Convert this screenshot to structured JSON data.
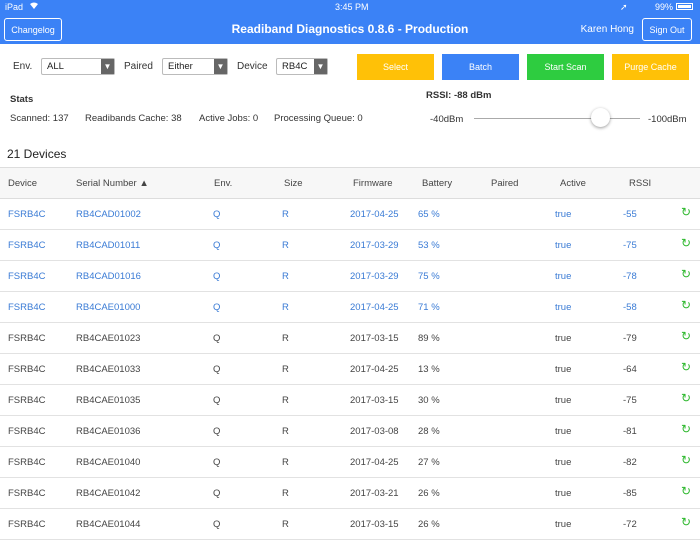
{
  "statusbar": {
    "device": "iPad",
    "time": "3:45 PM",
    "battery": "99%"
  },
  "header": {
    "changelog": "Changelog",
    "title": "Readiband Diagnostics 0.8.6 - Production",
    "user": "Karen Hong",
    "signout": "Sign Out"
  },
  "filters": {
    "env_label": "Env.",
    "env_value": "ALL",
    "paired_label": "Paired",
    "paired_value": "Either",
    "device_label": "Device",
    "device_value": "RB4C"
  },
  "actions": {
    "select": "Select",
    "batch": "Batch",
    "start_scan": "Start Scan",
    "purge_cache": "Purge Cache"
  },
  "colors": {
    "header": "#3b82f6",
    "select": "#ffc107",
    "batch": "#3b82f6",
    "start_scan": "#2ecc40",
    "purge_cache": "#ffc107",
    "link": "#3a7bd5",
    "refresh": "#2eb82e"
  },
  "stats": {
    "title": "Stats",
    "scanned": "Scanned: 137",
    "cache": "Readibands Cache: 38",
    "active_jobs": "Active Jobs: 0",
    "queue": "Processing Queue: 0"
  },
  "rssi": {
    "title": "RSSI: -88 dBm",
    "min_label": "-40dBm",
    "max_label": "-100dBm",
    "value": -88
  },
  "devices": {
    "count_label": "21 Devices",
    "columns": [
      "Device",
      "Serial Number ▲",
      "Env.",
      "Size",
      "Firmware",
      "Battery",
      "Paired",
      "Active",
      "RSSI"
    ],
    "rows": [
      {
        "device": "FSRB4C",
        "serial": "RB4CAD01002",
        "env": "Q",
        "size": "R",
        "firmware": "2017-04-25",
        "battery": "65 %",
        "paired": "",
        "active": "true",
        "rssi": "-55",
        "highlight": true
      },
      {
        "device": "FSRB4C",
        "serial": "RB4CAD01011",
        "env": "Q",
        "size": "R",
        "firmware": "2017-03-29",
        "battery": "53 %",
        "paired": "",
        "active": "true",
        "rssi": "-75",
        "highlight": true
      },
      {
        "device": "FSRB4C",
        "serial": "RB4CAD01016",
        "env": "Q",
        "size": "R",
        "firmware": "2017-03-29",
        "battery": "75 %",
        "paired": "",
        "active": "true",
        "rssi": "-78",
        "highlight": true
      },
      {
        "device": "FSRB4C",
        "serial": "RB4CAE01000",
        "env": "Q",
        "size": "R",
        "firmware": "2017-04-25",
        "battery": "71 %",
        "paired": "",
        "active": "true",
        "rssi": "-58",
        "highlight": true
      },
      {
        "device": "FSRB4C",
        "serial": "RB4CAE01023",
        "env": "Q",
        "size": "R",
        "firmware": "2017-03-15",
        "battery": "89 %",
        "paired": "",
        "active": "true",
        "rssi": "-79",
        "highlight": false
      },
      {
        "device": "FSRB4C",
        "serial": "RB4CAE01033",
        "env": "Q",
        "size": "R",
        "firmware": "2017-04-25",
        "battery": "13 %",
        "paired": "",
        "active": "true",
        "rssi": "-64",
        "highlight": false
      },
      {
        "device": "FSRB4C",
        "serial": "RB4CAE01035",
        "env": "Q",
        "size": "R",
        "firmware": "2017-03-15",
        "battery": "30 %",
        "paired": "",
        "active": "true",
        "rssi": "-75",
        "highlight": false
      },
      {
        "device": "FSRB4C",
        "serial": "RB4CAE01036",
        "env": "Q",
        "size": "R",
        "firmware": "2017-03-08",
        "battery": "28 %",
        "paired": "",
        "active": "true",
        "rssi": "-81",
        "highlight": false
      },
      {
        "device": "FSRB4C",
        "serial": "RB4CAE01040",
        "env": "Q",
        "size": "R",
        "firmware": "2017-04-25",
        "battery": "27 %",
        "paired": "",
        "active": "true",
        "rssi": "-82",
        "highlight": false
      },
      {
        "device": "FSRB4C",
        "serial": "RB4CAE01042",
        "env": "Q",
        "size": "R",
        "firmware": "2017-03-21",
        "battery": "26 %",
        "paired": "",
        "active": "true",
        "rssi": "-85",
        "highlight": false
      },
      {
        "device": "FSRB4C",
        "serial": "RB4CAE01044",
        "env": "Q",
        "size": "R",
        "firmware": "2017-03-15",
        "battery": "26 %",
        "paired": "",
        "active": "true",
        "rssi": "-72",
        "highlight": false
      }
    ],
    "refresh_icon": "refresh-icon"
  }
}
